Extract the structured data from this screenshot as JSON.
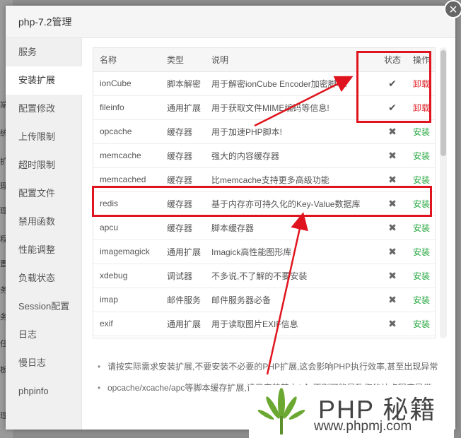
{
  "dialog": {
    "title": "php-7.2管理",
    "close_glyph": "×"
  },
  "sidebar": {
    "items": [
      {
        "label": "服务"
      },
      {
        "label": "安装扩展"
      },
      {
        "label": "配置修改"
      },
      {
        "label": "上传限制"
      },
      {
        "label": "超时限制"
      },
      {
        "label": "配置文件"
      },
      {
        "label": "禁用函数"
      },
      {
        "label": "性能调整"
      },
      {
        "label": "负载状态"
      },
      {
        "label": "Session配置"
      },
      {
        "label": "日志"
      },
      {
        "label": "慢日志"
      },
      {
        "label": "phpinfo"
      }
    ]
  },
  "table": {
    "headers": {
      "name": "名称",
      "type": "类型",
      "desc": "说明",
      "status": "状态",
      "op": "操作"
    },
    "rows": [
      {
        "name": "ionCube",
        "type": "脚本解密",
        "desc": "用于解密ionCube Encoder加密脚本!",
        "status": "✔",
        "op": "卸载"
      },
      {
        "name": "fileinfo",
        "type": "通用扩展",
        "desc": "用于获取文件MIME编码等信息!",
        "status": "✔",
        "op": "卸载"
      },
      {
        "name": "opcache",
        "type": "缓存器",
        "desc": "用于加速PHP脚本!",
        "status": "✖",
        "op": "安装"
      },
      {
        "name": "memcache",
        "type": "缓存器",
        "desc": "强大的内容缓存器",
        "status": "✖",
        "op": "安装"
      },
      {
        "name": "memcached",
        "type": "缓存器",
        "desc": "比memcache支持更多高级功能",
        "status": "✖",
        "op": "安装"
      },
      {
        "name": "redis",
        "type": "缓存器",
        "desc": "基于内存亦可持久化的Key-Value数据库",
        "status": "✖",
        "op": "安装"
      },
      {
        "name": "apcu",
        "type": "缓存器",
        "desc": "脚本缓存器",
        "status": "✖",
        "op": "安装"
      },
      {
        "name": "imagemagick",
        "type": "通用扩展",
        "desc": "Imagick高性能图形库",
        "status": "✖",
        "op": "安装"
      },
      {
        "name": "xdebug",
        "type": "调试器",
        "desc": "不多说,不了解的不要安装",
        "status": "✖",
        "op": "安装"
      },
      {
        "name": "imap",
        "type": "邮件服务",
        "desc": "邮件服务器必备",
        "status": "✖",
        "op": "安装"
      },
      {
        "name": "exif",
        "type": "通用扩展",
        "desc": "用于读取图片EXIF信息",
        "status": "✖",
        "op": "安装"
      },
      {
        "name": "",
        "type": "",
        "desc": "",
        "status": "",
        "op": ""
      }
    ]
  },
  "notes": [
    "请按实际需求安装扩展,不要安装不必要的PHP扩展,这会影响PHP执行效率,甚至出现异常",
    "opcache/xcache/apc等脚本缓存扩展,请只安装其中1个,否则可能导致您的站点程序异常"
  ],
  "watermark": {
    "title": "PHP 秘籍",
    "url": "www.phpmj.com"
  },
  "colors": {
    "annotation": "#e0141e",
    "install": "#20a53a",
    "uninstall": "#e0262b"
  },
  "background_text": [
    "端",
    "统",
    "扩",
    "理",
    "理",
    "程",
    "置",
    "务",
    "务",
    "任",
    "板",
    "理"
  ]
}
